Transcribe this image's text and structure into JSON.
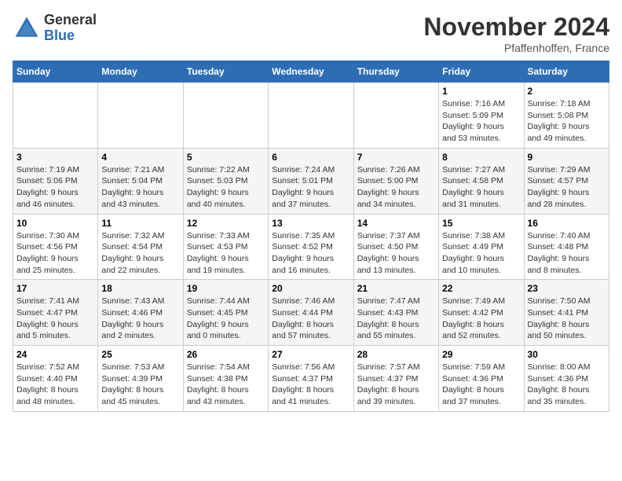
{
  "logo": {
    "general": "General",
    "blue": "Blue"
  },
  "title": "November 2024",
  "location": "Pfaffenhoffen, France",
  "weekdays": [
    "Sunday",
    "Monday",
    "Tuesday",
    "Wednesday",
    "Thursday",
    "Friday",
    "Saturday"
  ],
  "weeks": [
    [
      {
        "day": "",
        "info": ""
      },
      {
        "day": "",
        "info": ""
      },
      {
        "day": "",
        "info": ""
      },
      {
        "day": "",
        "info": ""
      },
      {
        "day": "",
        "info": ""
      },
      {
        "day": "1",
        "info": "Sunrise: 7:16 AM\nSunset: 5:09 PM\nDaylight: 9 hours\nand 53 minutes."
      },
      {
        "day": "2",
        "info": "Sunrise: 7:18 AM\nSunset: 5:08 PM\nDaylight: 9 hours\nand 49 minutes."
      }
    ],
    [
      {
        "day": "3",
        "info": "Sunrise: 7:19 AM\nSunset: 5:06 PM\nDaylight: 9 hours\nand 46 minutes."
      },
      {
        "day": "4",
        "info": "Sunrise: 7:21 AM\nSunset: 5:04 PM\nDaylight: 9 hours\nand 43 minutes."
      },
      {
        "day": "5",
        "info": "Sunrise: 7:22 AM\nSunset: 5:03 PM\nDaylight: 9 hours\nand 40 minutes."
      },
      {
        "day": "6",
        "info": "Sunrise: 7:24 AM\nSunset: 5:01 PM\nDaylight: 9 hours\nand 37 minutes."
      },
      {
        "day": "7",
        "info": "Sunrise: 7:26 AM\nSunset: 5:00 PM\nDaylight: 9 hours\nand 34 minutes."
      },
      {
        "day": "8",
        "info": "Sunrise: 7:27 AM\nSunset: 4:58 PM\nDaylight: 9 hours\nand 31 minutes."
      },
      {
        "day": "9",
        "info": "Sunrise: 7:29 AM\nSunset: 4:57 PM\nDaylight: 9 hours\nand 28 minutes."
      }
    ],
    [
      {
        "day": "10",
        "info": "Sunrise: 7:30 AM\nSunset: 4:56 PM\nDaylight: 9 hours\nand 25 minutes."
      },
      {
        "day": "11",
        "info": "Sunrise: 7:32 AM\nSunset: 4:54 PM\nDaylight: 9 hours\nand 22 minutes."
      },
      {
        "day": "12",
        "info": "Sunrise: 7:33 AM\nSunset: 4:53 PM\nDaylight: 9 hours\nand 19 minutes."
      },
      {
        "day": "13",
        "info": "Sunrise: 7:35 AM\nSunset: 4:52 PM\nDaylight: 9 hours\nand 16 minutes."
      },
      {
        "day": "14",
        "info": "Sunrise: 7:37 AM\nSunset: 4:50 PM\nDaylight: 9 hours\nand 13 minutes."
      },
      {
        "day": "15",
        "info": "Sunrise: 7:38 AM\nSunset: 4:49 PM\nDaylight: 9 hours\nand 10 minutes."
      },
      {
        "day": "16",
        "info": "Sunrise: 7:40 AM\nSunset: 4:48 PM\nDaylight: 9 hours\nand 8 minutes."
      }
    ],
    [
      {
        "day": "17",
        "info": "Sunrise: 7:41 AM\nSunset: 4:47 PM\nDaylight: 9 hours\nand 5 minutes."
      },
      {
        "day": "18",
        "info": "Sunrise: 7:43 AM\nSunset: 4:46 PM\nDaylight: 9 hours\nand 2 minutes."
      },
      {
        "day": "19",
        "info": "Sunrise: 7:44 AM\nSunset: 4:45 PM\nDaylight: 9 hours\nand 0 minutes."
      },
      {
        "day": "20",
        "info": "Sunrise: 7:46 AM\nSunset: 4:44 PM\nDaylight: 8 hours\nand 57 minutes."
      },
      {
        "day": "21",
        "info": "Sunrise: 7:47 AM\nSunset: 4:43 PM\nDaylight: 8 hours\nand 55 minutes."
      },
      {
        "day": "22",
        "info": "Sunrise: 7:49 AM\nSunset: 4:42 PM\nDaylight: 8 hours\nand 52 minutes."
      },
      {
        "day": "23",
        "info": "Sunrise: 7:50 AM\nSunset: 4:41 PM\nDaylight: 8 hours\nand 50 minutes."
      }
    ],
    [
      {
        "day": "24",
        "info": "Sunrise: 7:52 AM\nSunset: 4:40 PM\nDaylight: 8 hours\nand 48 minutes."
      },
      {
        "day": "25",
        "info": "Sunrise: 7:53 AM\nSunset: 4:39 PM\nDaylight: 8 hours\nand 45 minutes."
      },
      {
        "day": "26",
        "info": "Sunrise: 7:54 AM\nSunset: 4:38 PM\nDaylight: 8 hours\nand 43 minutes."
      },
      {
        "day": "27",
        "info": "Sunrise: 7:56 AM\nSunset: 4:37 PM\nDaylight: 8 hours\nand 41 minutes."
      },
      {
        "day": "28",
        "info": "Sunrise: 7:57 AM\nSunset: 4:37 PM\nDaylight: 8 hours\nand 39 minutes."
      },
      {
        "day": "29",
        "info": "Sunrise: 7:59 AM\nSunset: 4:36 PM\nDaylight: 8 hours\nand 37 minutes."
      },
      {
        "day": "30",
        "info": "Sunrise: 8:00 AM\nSunset: 4:36 PM\nDaylight: 8 hours\nand 35 minutes."
      }
    ]
  ]
}
